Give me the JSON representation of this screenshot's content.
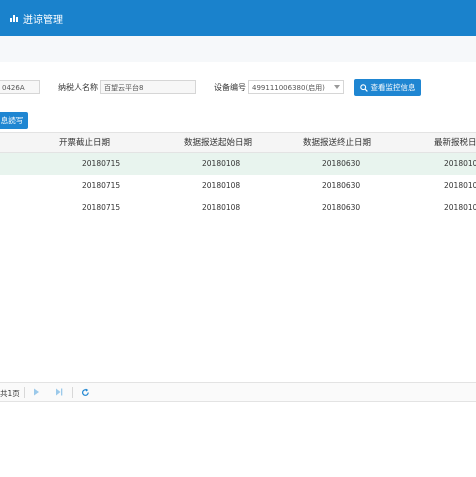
{
  "header": {
    "title": "迸谅管理",
    "icon": "chart-icon"
  },
  "filters": {
    "tax_id": {
      "value": "0426A"
    },
    "taxpayer": {
      "label": "纳税人名称",
      "value": "百望云平台8"
    },
    "device": {
      "label": "设备编号",
      "value": "499111006380(启用)"
    },
    "query_button": "查看监控信息"
  },
  "toolbar": {
    "button_label": "息読写"
  },
  "table": {
    "columns": [
      "开票截止日期",
      "数据报送起始日期",
      "数据报送终止日期",
      "最新报税日"
    ],
    "rows": [
      [
        "20180715",
        "20180108",
        "20180630",
        "2018010"
      ],
      [
        "20180715",
        "20180108",
        "20180630",
        "2018010"
      ],
      [
        "20180715",
        "20180108",
        "20180630",
        "2018010"
      ]
    ]
  },
  "pager": {
    "total_pages": "共1页"
  },
  "colors": {
    "accent": "#1a82cc",
    "button": "#1f86d2",
    "selected_row": "#e8f4ee"
  }
}
